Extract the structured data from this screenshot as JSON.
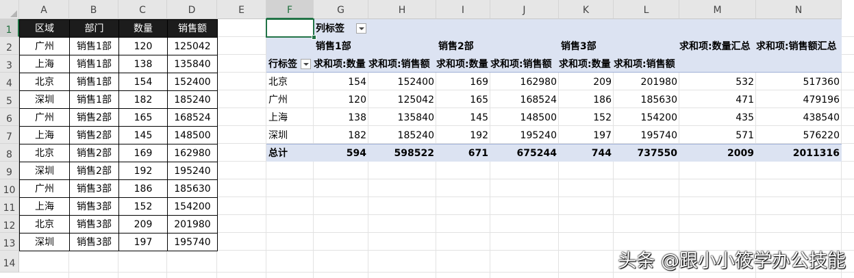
{
  "columns": [
    "A",
    "B",
    "C",
    "D",
    "E",
    "F",
    "G",
    "H",
    "I",
    "J",
    "K",
    "L",
    "M",
    "N"
  ],
  "rows": [
    "1",
    "2",
    "3",
    "4",
    "5",
    "6",
    "7",
    "8",
    "9",
    "10",
    "11",
    "12",
    "13",
    "14"
  ],
  "source_table": {
    "headers": [
      "区域",
      "部门",
      "数量",
      "销售额"
    ],
    "rows": [
      [
        "广州",
        "销售1部",
        "120",
        "125042"
      ],
      [
        "上海",
        "销售1部",
        "138",
        "135840"
      ],
      [
        "北京",
        "销售1部",
        "154",
        "152400"
      ],
      [
        "深圳",
        "销售1部",
        "182",
        "185240"
      ],
      [
        "广州",
        "销售2部",
        "165",
        "168524"
      ],
      [
        "上海",
        "销售2部",
        "145",
        "148500"
      ],
      [
        "北京",
        "销售2部",
        "169",
        "162980"
      ],
      [
        "深圳",
        "销售2部",
        "192",
        "195240"
      ],
      [
        "广州",
        "销售3部",
        "186",
        "185630"
      ],
      [
        "上海",
        "销售3部",
        "152",
        "154200"
      ],
      [
        "北京",
        "销售3部",
        "209",
        "201980"
      ],
      [
        "深圳",
        "销售3部",
        "197",
        "195740"
      ]
    ]
  },
  "pivot": {
    "column_label": "列标签",
    "row_label": "行标签",
    "groups": [
      "销售1部",
      "销售2部",
      "销售3部"
    ],
    "sum_qty_total": "求和项:数量汇总",
    "sum_sales_total": "求和项:销售额汇总",
    "measure_qty": "求和项:数量",
    "measure_sales": "求和项:销售额",
    "rows": [
      [
        "北京",
        "154",
        "152400",
        "169",
        "162980",
        "209",
        "201980",
        "532",
        "517360"
      ],
      [
        "广州",
        "120",
        "125042",
        "165",
        "168524",
        "186",
        "185630",
        "471",
        "479196"
      ],
      [
        "上海",
        "138",
        "135840",
        "145",
        "148500",
        "152",
        "154200",
        "435",
        "438540"
      ],
      [
        "深圳",
        "182",
        "185240",
        "192",
        "195240",
        "197",
        "195740",
        "571",
        "576220"
      ]
    ],
    "total": [
      "总计",
      "594",
      "598522",
      "671",
      "675244",
      "744",
      "737550",
      "2009",
      "2011316"
    ]
  },
  "watermark": "头条 @跟小小筱学办公技能"
}
